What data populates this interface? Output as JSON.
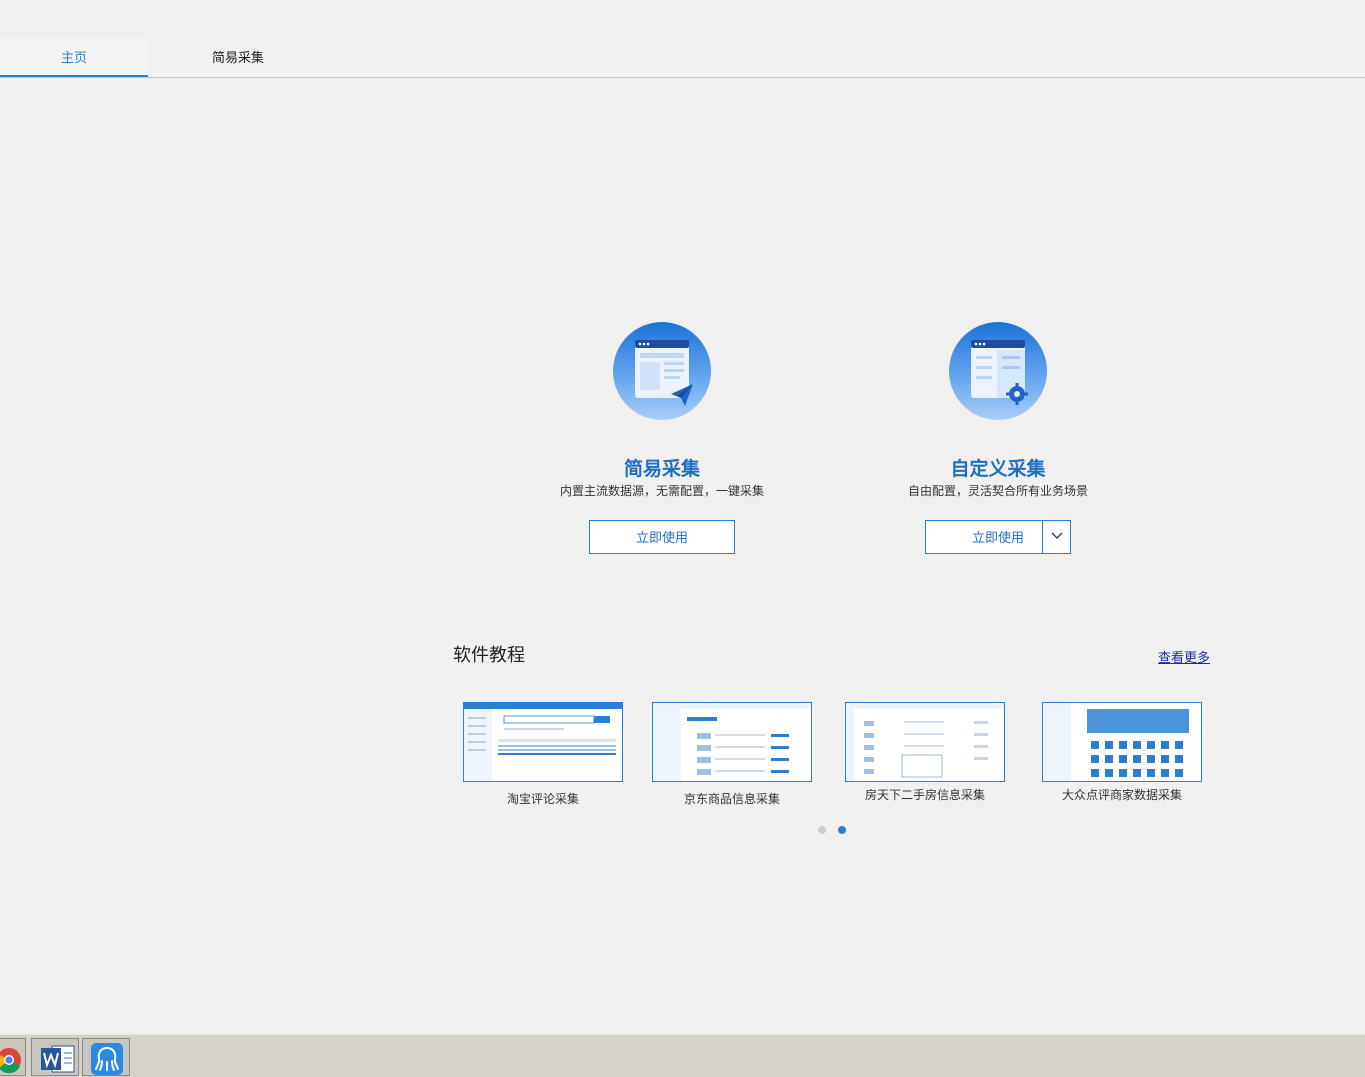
{
  "tabs": [
    {
      "label": "主页",
      "active": true
    },
    {
      "label": "简易采集",
      "active": false
    }
  ],
  "cards": [
    {
      "title": "简易采集",
      "description": "内置主流数据源，无需配置，一键采集",
      "button": "立即使用"
    },
    {
      "title": "自定义采集",
      "description": "自由配置，灵活契合所有业务场景",
      "button": "立即使用"
    }
  ],
  "tutorials": {
    "title": "软件教程",
    "see_more": "查看更多",
    "items": [
      {
        "label": "淘宝评论采集"
      },
      {
        "label": "京东商品信息采集"
      },
      {
        "label": "房天下二手房信息采集"
      },
      {
        "label": "大众点评商家数据采集"
      }
    ],
    "pagination": {
      "pages": 2,
      "current": 2
    }
  },
  "taskbar": {
    "apps": [
      "chrome-icon",
      "word-icon",
      "octopus-app-icon"
    ]
  },
  "colors": {
    "accent": "#2b7fd0",
    "title_blue": "#1e6fc2",
    "background": "#f0f0f0"
  }
}
